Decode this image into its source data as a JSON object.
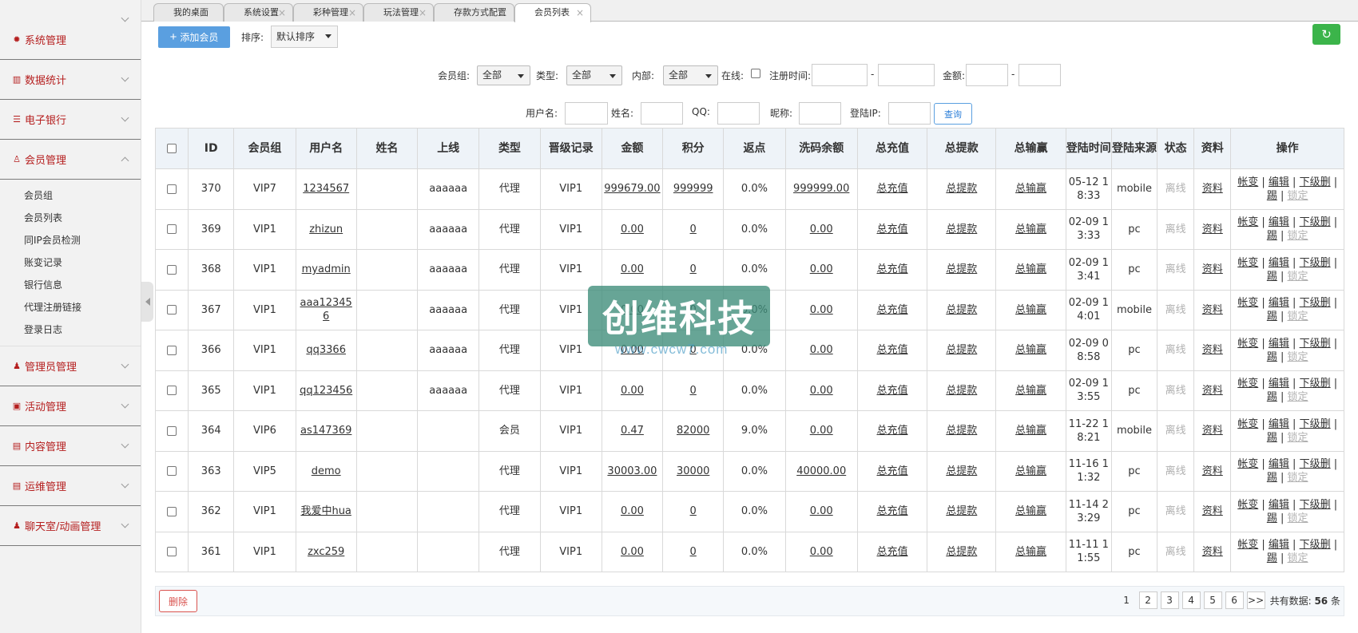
{
  "sidebar": {
    "groups": [
      {
        "label": "系统管理",
        "icon": "gear-icon"
      },
      {
        "label": "数据统计",
        "icon": "chart-icon"
      },
      {
        "label": "电子银行",
        "icon": "list-icon"
      },
      {
        "label": "会员管理",
        "icon": "user-icon",
        "expanded": true,
        "items": [
          "会员组",
          "会员列表",
          "同IP会员检测",
          "账变记录",
          "银行信息",
          "代理注册链接",
          "登录日志"
        ]
      },
      {
        "label": "管理员管理",
        "icon": "admin-icon"
      },
      {
        "label": "活动管理",
        "icon": "gift-icon"
      },
      {
        "label": "内容管理",
        "icon": "doc-icon"
      },
      {
        "label": "运维管理",
        "icon": "doc-icon"
      },
      {
        "label": "聊天室/动画管理",
        "icon": "admin-icon"
      }
    ]
  },
  "tabs": [
    {
      "label": "我的桌面"
    },
    {
      "label": "系统设置"
    },
    {
      "label": "彩种管理"
    },
    {
      "label": "玩法管理"
    },
    {
      "label": "存款方式配置"
    },
    {
      "label": "会员列表",
      "active": true
    }
  ],
  "toolbar": {
    "add_label": "添加会员",
    "sort_label": "排序:",
    "sort_value": "默认排序"
  },
  "filters": {
    "group_label": "会员组:",
    "group_value": "全部",
    "type_label": "类型:",
    "type_value": "全部",
    "internal_label": "内部:",
    "internal_value": "全部",
    "online_label": "在线:",
    "regtime_label": "注册时间:",
    "amount_label": "金额:",
    "dash": "-",
    "username_label": "用户名:",
    "name_label": "姓名:",
    "qq_label": "QQ:",
    "nickname_label": "昵称:",
    "loginip_label": "登陆IP:",
    "query_label": "查询"
  },
  "table": {
    "headers": [
      "ID",
      "会员组",
      "用户名",
      "姓名",
      "上线",
      "类型",
      "晋级记录",
      "金额",
      "积分",
      "返点",
      "洗码余额",
      "总充值",
      "总提款",
      "总输赢",
      "登陆时间",
      "登陆来源",
      "状态",
      "资料",
      "操作"
    ],
    "ops": {
      "zhangbian": "帐变",
      "edit": "编辑",
      "sub": "下级",
      "del": "删",
      "kick": "踢",
      "lock": "锁定",
      "sep": "|"
    },
    "rows": [
      {
        "id": "370",
        "group": "VIP7",
        "username": "1234567",
        "name": "",
        "upline": "aaaaaa",
        "type": "代理",
        "promo": "VIP1",
        "amount": "999679.00",
        "points": "999999",
        "rebate": "0.0%",
        "wash": "999999.00",
        "recharge": "总充值",
        "withdraw": "总提款",
        "winloss": "总输赢",
        "login_time": "05-12 18:33",
        "source": "mobile",
        "status": "离线",
        "profile": "资料"
      },
      {
        "id": "369",
        "group": "VIP1",
        "username": "zhizun",
        "name": "",
        "upline": "aaaaaa",
        "type": "代理",
        "promo": "VIP1",
        "amount": "0.00",
        "points": "0",
        "rebate": "0.0%",
        "wash": "0.00",
        "recharge": "总充值",
        "withdraw": "总提款",
        "winloss": "总输赢",
        "login_time": "02-09 13:33",
        "source": "pc",
        "status": "离线",
        "profile": "资料"
      },
      {
        "id": "368",
        "group": "VIP1",
        "username": "myadmin",
        "name": "",
        "upline": "aaaaaa",
        "type": "代理",
        "promo": "VIP1",
        "amount": "0.00",
        "points": "0",
        "rebate": "0.0%",
        "wash": "0.00",
        "recharge": "总充值",
        "withdraw": "总提款",
        "winloss": "总输赢",
        "login_time": "02-09 13:41",
        "source": "pc",
        "status": "离线",
        "profile": "资料"
      },
      {
        "id": "367",
        "group": "VIP1",
        "username": "aaa123456",
        "name": "",
        "upline": "aaaaaa",
        "type": "代理",
        "promo": "VIP1",
        "amount": "0.00",
        "points": "0",
        "rebate": "0.0%",
        "wash": "0.00",
        "recharge": "总充值",
        "withdraw": "总提款",
        "winloss": "总输赢",
        "login_time": "02-09 14:01",
        "source": "mobile",
        "status": "离线",
        "profile": "资料"
      },
      {
        "id": "366",
        "group": "VIP1",
        "username": "qq3366",
        "name": "",
        "upline": "aaaaaa",
        "type": "代理",
        "promo": "VIP1",
        "amount": "0.00",
        "points": "0",
        "rebate": "0.0%",
        "wash": "0.00",
        "recharge": "总充值",
        "withdraw": "总提款",
        "winloss": "总输赢",
        "login_time": "02-09 08:58",
        "source": "pc",
        "status": "离线",
        "profile": "资料"
      },
      {
        "id": "365",
        "group": "VIP1",
        "username": "qq123456",
        "name": "",
        "upline": "aaaaaa",
        "type": "代理",
        "promo": "VIP1",
        "amount": "0.00",
        "points": "0",
        "rebate": "0.0%",
        "wash": "0.00",
        "recharge": "总充值",
        "withdraw": "总提款",
        "winloss": "总输赢",
        "login_time": "02-09 13:55",
        "source": "pc",
        "status": "离线",
        "profile": "资料"
      },
      {
        "id": "364",
        "group": "VIP6",
        "username": "as147369",
        "name": "",
        "upline": "",
        "type": "会员",
        "promo": "VIP1",
        "amount": "0.47",
        "points": "82000",
        "rebate": "9.0%",
        "wash": "0.00",
        "recharge": "总充值",
        "withdraw": "总提款",
        "winloss": "总输赢",
        "login_time": "11-22 18:21",
        "source": "mobile",
        "status": "离线",
        "profile": "资料"
      },
      {
        "id": "363",
        "group": "VIP5",
        "username": "demo",
        "name": "",
        "upline": "",
        "type": "代理",
        "promo": "VIP1",
        "amount": "30003.00",
        "points": "30000",
        "rebate": "0.0%",
        "wash": "40000.00",
        "recharge": "总充值",
        "withdraw": "总提款",
        "winloss": "总输赢",
        "login_time": "11-16 11:32",
        "source": "pc",
        "status": "离线",
        "profile": "资料"
      },
      {
        "id": "362",
        "group": "VIP1",
        "username": "我爱中hua",
        "name": "",
        "upline": "",
        "type": "代理",
        "promo": "VIP1",
        "amount": "0.00",
        "points": "0",
        "rebate": "0.0%",
        "wash": "0.00",
        "recharge": "总充值",
        "withdraw": "总提款",
        "winloss": "总输赢",
        "login_time": "11-14 23:29",
        "source": "pc",
        "status": "离线",
        "profile": "资料"
      },
      {
        "id": "361",
        "group": "VIP1",
        "username": "zxc259",
        "name": "",
        "upline": "",
        "type": "代理",
        "promo": "VIP1",
        "amount": "0.00",
        "points": "0",
        "rebate": "0.0%",
        "wash": "0.00",
        "recharge": "总充值",
        "withdraw": "总提款",
        "winloss": "总输赢",
        "login_time": "11-11 11:55",
        "source": "pc",
        "status": "离线",
        "profile": "资料"
      }
    ]
  },
  "footer": {
    "delete_label": "删除",
    "pages": [
      "1",
      "2",
      "3",
      "4",
      "5",
      "6"
    ],
    "next_label": ">>",
    "total_prefix": "共有数据:",
    "total_count": "56",
    "total_suffix": "条"
  },
  "watermark": {
    "title": "创维科技",
    "url": "www.cwcw7.com"
  },
  "colors": {
    "menu_text": "#b51e1e",
    "add_button": "#5a9fe0",
    "refresh_button": "#3bb44a",
    "delete_border": "#d9534f"
  }
}
